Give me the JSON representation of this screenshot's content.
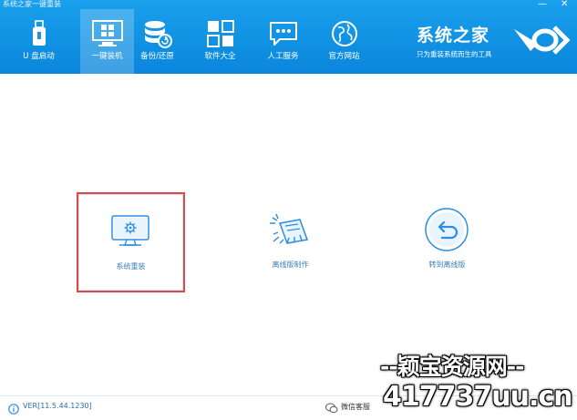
{
  "window": {
    "title": "系统之家一键重装",
    "minimize_glyph": "—",
    "close_glyph": "✕"
  },
  "nav": {
    "items": [
      {
        "label": "U 盘启动",
        "icon": "usb-drive-icon"
      },
      {
        "label": "一键装机",
        "icon": "monitor-windows-icon"
      },
      {
        "label": "备份/还原",
        "icon": "database-restore-icon"
      },
      {
        "label": "软件大全",
        "icon": "apps-grid-icon"
      },
      {
        "label": "人工服务",
        "icon": "chat-bubble-icon"
      },
      {
        "label": "官方网站",
        "icon": "globe-icon"
      }
    ],
    "active_index": 1
  },
  "brand": {
    "name": "系统之家",
    "tagline": "只为重装系统而生的工具",
    "logo_icon": "logo-icon"
  },
  "main": {
    "cards": [
      {
        "label": "系统重装",
        "icon": "monitor-gear-icon",
        "selected": true
      },
      {
        "label": "离线版制作",
        "icon": "offline-package-icon",
        "selected": false
      },
      {
        "label": "转到离线版",
        "icon": "return-arrow-icon",
        "selected": false
      }
    ]
  },
  "footer": {
    "version": "VER[11.5.44.1230]",
    "wechat_label": "微信客服"
  },
  "watermark": {
    "line1": "--颖宝资源网--",
    "line2": "417737uu.cn"
  },
  "colors": {
    "header_blue": "#0c8fe0",
    "accent_blue": "#2a8ee6",
    "selected_border": "#e04848"
  }
}
